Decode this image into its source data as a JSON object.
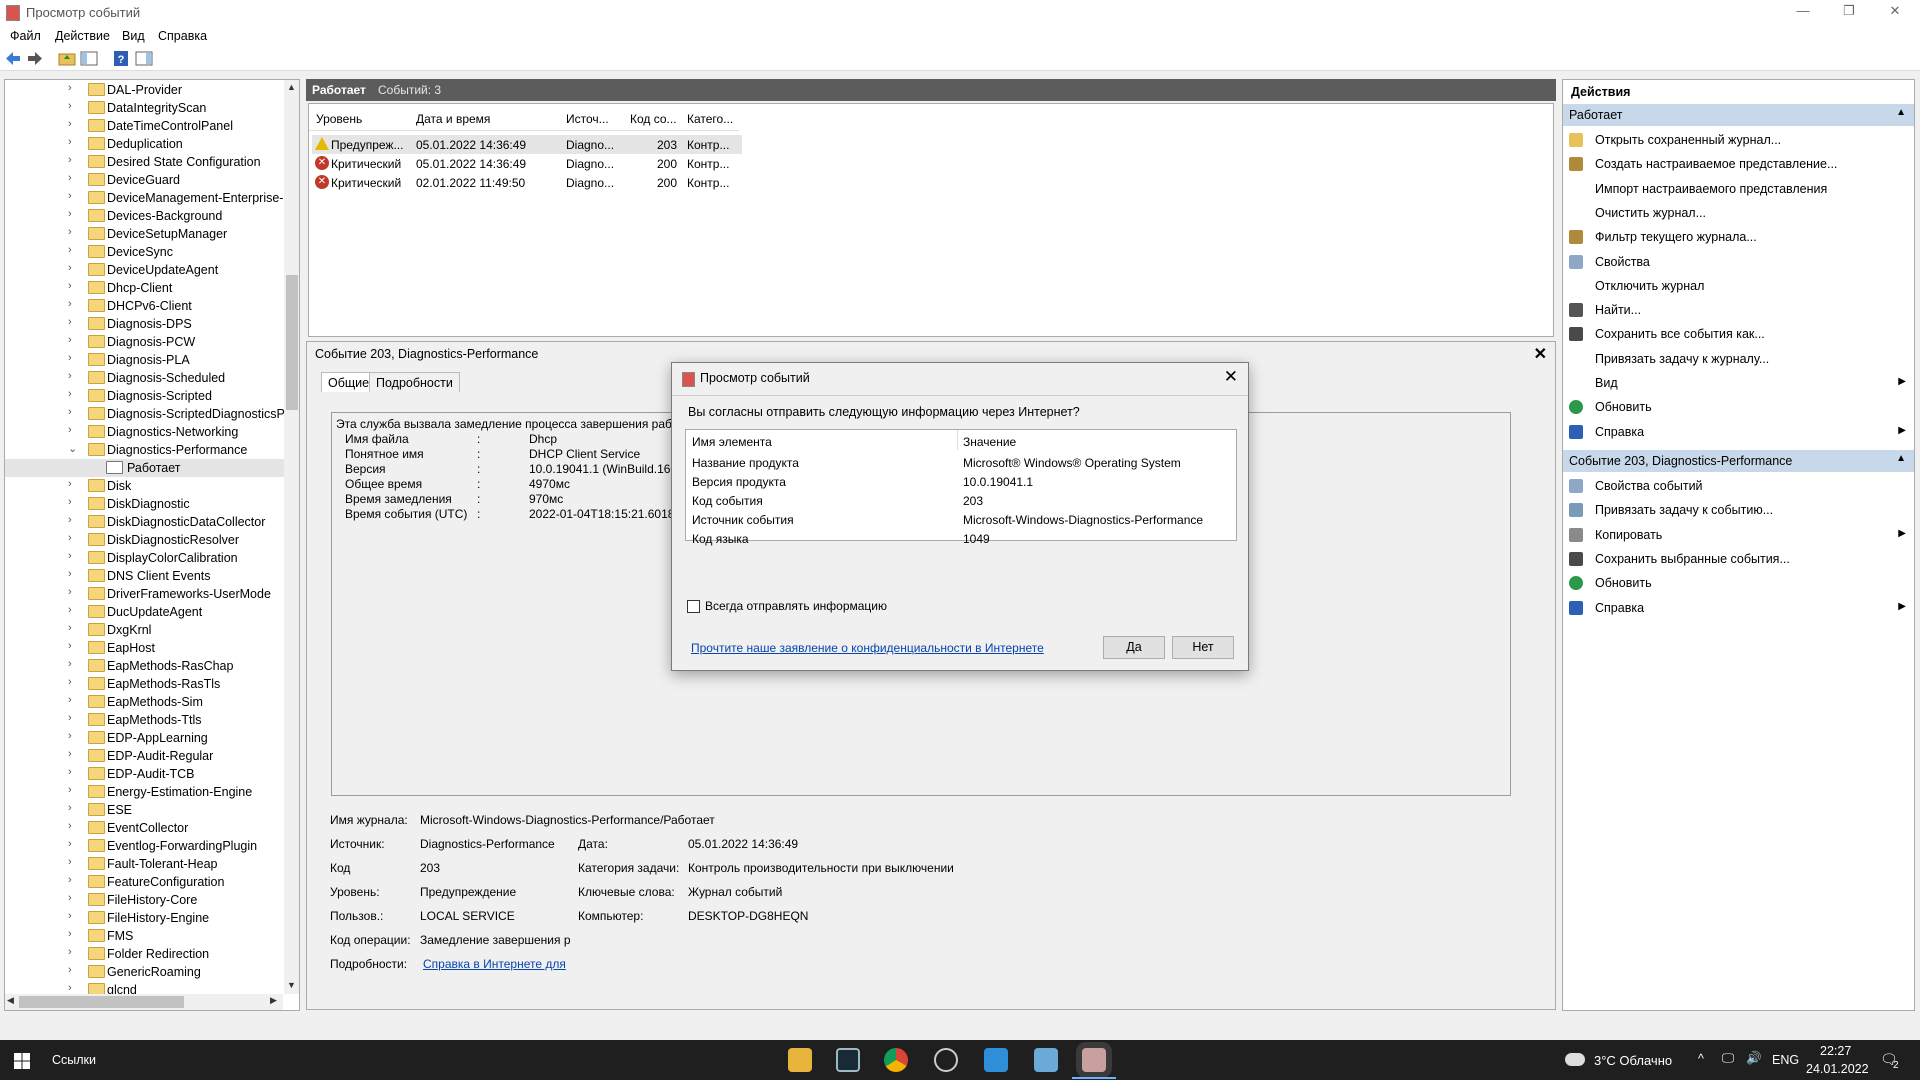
{
  "window": {
    "title": "Просмотр событий",
    "controls": [
      "—",
      "❐",
      "✕"
    ]
  },
  "menu": [
    "Файл",
    "Действие",
    "Вид",
    "Справка"
  ],
  "tree": {
    "items": [
      "DAL-Provider",
      "DataIntegrityScan",
      "DateTimeControlPanel",
      "Deduplication",
      "Desired State Configuration",
      "DeviceGuard",
      "DeviceManagement-Enterprise-D",
      "Devices-Background",
      "DeviceSetupManager",
      "DeviceSync",
      "DeviceUpdateAgent",
      "Dhcp-Client",
      "DHCPv6-Client",
      "Diagnosis-DPS",
      "Diagnosis-PCW",
      "Diagnosis-PLA",
      "Diagnosis-Scheduled",
      "Diagnosis-Scripted",
      "Diagnosis-ScriptedDiagnosticsPro",
      "Diagnostics-Networking",
      "Diagnostics-Performance",
      "Работает",
      "Disk",
      "DiskDiagnostic",
      "DiskDiagnosticDataCollector",
      "DiskDiagnosticResolver",
      "DisplayColorCalibration",
      "DNS Client Events",
      "DriverFrameworks-UserMode",
      "DucUpdateAgent",
      "DxgKrnl",
      "EapHost",
      "EapMethods-RasChap",
      "EapMethods-RasTls",
      "EapMethods-Sim",
      "EapMethods-Ttls",
      "EDP-AppLearning",
      "EDP-Audit-Regular",
      "EDP-Audit-TCB",
      "Energy-Estimation-Engine",
      "ESE",
      "EventCollector",
      "Eventlog-ForwardingPlugin",
      "Fault-Tolerant-Heap",
      "FeatureConfiguration",
      "FileHistory-Core",
      "FileHistory-Engine",
      "FMS",
      "Folder Redirection",
      "GenericRoaming",
      "glcnd"
    ]
  },
  "events": {
    "header_title": "Работает",
    "header_count": "Событий: 3",
    "columns": [
      "Уровень",
      "Дата и время",
      "Источ...",
      "Код со...",
      "Катего..."
    ],
    "rows": [
      {
        "level": "Предупреж...",
        "date": "05.01.2022 14:36:49",
        "source": "Diagno...",
        "code": "203",
        "cat": "Контр..."
      },
      {
        "level": "Критический",
        "date": "05.01.2022 14:36:49",
        "source": "Diagno...",
        "code": "200",
        "cat": "Контр..."
      },
      {
        "level": "Критический",
        "date": "02.01.2022 11:49:50",
        "source": "Diagno...",
        "code": "200",
        "cat": "Контр..."
      }
    ]
  },
  "detail": {
    "title": "Событие 203, Diagnostics-Performance",
    "close": "✕",
    "tabs": [
      "Общие",
      "Подробности"
    ],
    "desc_first": "Эта служба вызвала замедление процесса завершения работ",
    "desc_rows": [
      {
        "k": "Имя файла",
        "v": "Dhcp"
      },
      {
        "k": "Понятное имя",
        "v": "DHCP Client Service"
      },
      {
        "k": "Версия",
        "v": "10.0.19041.1 (WinBuild.1601"
      },
      {
        "k": "Общее время",
        "v": "4970мс"
      },
      {
        "k": "Время замедления",
        "v": "970мс"
      },
      {
        "k": "Время события (UTC)",
        "v": "2022-01-04T18:15:21.601857"
      }
    ],
    "sep": ":",
    "fields": {
      "log_label": "Имя журнала:",
      "log": "Microsoft-Windows-Diagnostics-Performance/Работает",
      "source_label": "Источник:",
      "source": "Diagnostics-Performance",
      "date_label": "Дата:",
      "date": "05.01.2022 14:36:49",
      "code_label": "Код",
      "code": "203",
      "task_label": "Категория задачи:",
      "task": "Контроль производительности при выключении",
      "level_label": "Уровень:",
      "level": "Предупреждение",
      "keywords_label": "Ключевые слова:",
      "keywords": "Журнал событий",
      "user_label": "Пользов.:",
      "user": "LOCAL SERVICE",
      "computer_label": "Компьютер:",
      "computer": "DESKTOP-DG8HEQN",
      "opcode_label": "Код операции:",
      "opcode": "Замедление завершения ра",
      "more_label": "Подробности:",
      "more": "Справка в Интернете для"
    }
  },
  "actions": {
    "title": "Действия",
    "section1": "Работает",
    "items1": [
      {
        "label": "Открыть сохраненный журнал...",
        "icon": "folder-icon",
        "sub": ""
      },
      {
        "label": "Создать настраиваемое представление...",
        "icon": "filter-icon",
        "sub": ""
      },
      {
        "label": "Импорт настраиваемого представления",
        "icon": "",
        "sub": ""
      },
      {
        "label": "Очистить журнал...",
        "icon": "",
        "sub": ""
      },
      {
        "label": "Фильтр текущего журнала...",
        "icon": "filter-icon",
        "sub": ""
      },
      {
        "label": "Свойства",
        "icon": "properties-icon",
        "sub": ""
      },
      {
        "label": "Отключить журнал",
        "icon": "",
        "sub": ""
      },
      {
        "label": "Найти...",
        "icon": "binoculars-icon",
        "sub": ""
      },
      {
        "label": "Сохранить все события как...",
        "icon": "save-icon",
        "sub": ""
      },
      {
        "label": "Привязать задачу к журналу...",
        "icon": "",
        "sub": ""
      },
      {
        "label": "Вид",
        "icon": "",
        "sub": "▶"
      },
      {
        "label": "Обновить",
        "icon": "refresh-icon",
        "sub": ""
      },
      {
        "label": "Справка",
        "icon": "help-icon",
        "sub": "▶"
      }
    ],
    "section2": "Событие 203, Diagnostics-Performance",
    "items2": [
      {
        "label": "Свойства событий",
        "icon": "properties-icon",
        "sub": ""
      },
      {
        "label": "Привязать задачу к событию...",
        "icon": "task-icon",
        "sub": ""
      },
      {
        "label": "Копировать",
        "icon": "copy-icon",
        "sub": "▶"
      },
      {
        "label": "Сохранить выбранные события...",
        "icon": "save-icon",
        "sub": ""
      },
      {
        "label": "Обновить",
        "icon": "refresh-icon",
        "sub": ""
      },
      {
        "label": "Справка",
        "icon": "help-icon",
        "sub": "▶"
      }
    ]
  },
  "dialog": {
    "title": "Просмотр событий",
    "question": "Вы согласны отправить следующую информацию через Интернет?",
    "col1": "Имя элемента",
    "col2": "Значение",
    "rows": [
      {
        "k": "Название продукта",
        "v": "Microsoft® Windows® Operating System"
      },
      {
        "k": "Версия продукта",
        "v": "10.0.19041.1"
      },
      {
        "k": "Код события",
        "v": "203"
      },
      {
        "k": "Источник события",
        "v": "Microsoft-Windows-Diagnostics-Performance"
      },
      {
        "k": "Код языка",
        "v": "1049"
      }
    ],
    "always_send": "Всегда отправлять информацию",
    "privacy_link": "Прочтите наше заявление о конфиденциальности в Интернете",
    "yes": "Да",
    "no": "Нет"
  },
  "taskbar": {
    "links": "Ссылки",
    "weather": "3°C Облачно",
    "lang": "ENG",
    "time": "22:27",
    "date": "24.01.2022",
    "notifications": "2"
  }
}
